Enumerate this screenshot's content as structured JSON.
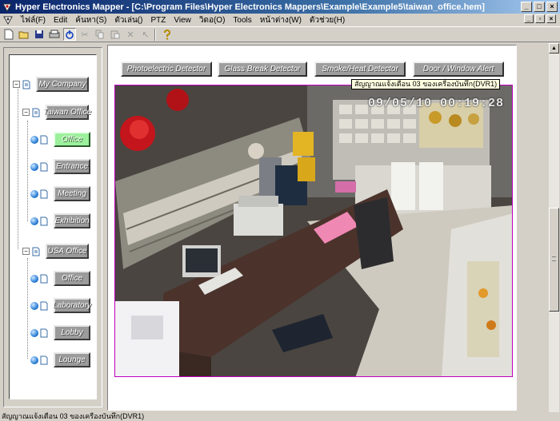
{
  "window": {
    "title": "Hyper Electronics Mapper - [C:\\Program Files\\Hyper Electronics Mappers\\Example\\Example5\\taiwan_office.hem]"
  },
  "menu": {
    "items": [
      "ไฟล์(F)",
      "Edit",
      "ค้นหา(S)",
      "ตัวเล่น()",
      "PTZ",
      "View",
      "วิดอ(O)",
      "Tools",
      "หน้าต่าง(W)",
      "ตัวช่วย(H)"
    ]
  },
  "toolbar": {
    "icons": [
      "new-icon",
      "open-icon",
      "save-icon",
      "print-icon",
      "power-icon",
      "cut-icon",
      "copy-icon",
      "paste-icon",
      "delete-icon",
      "pointer-icon",
      "help-icon"
    ]
  },
  "tree": {
    "root": "My Company",
    "taiwan_office": "Taiwan Office",
    "taiwan_children": [
      "Office",
      "Entrance",
      "Meeting",
      "Exhibition"
    ],
    "usa_office": "USA Office",
    "usa_children": [
      "Office",
      "Laboratory",
      "Lobby",
      "Lounge"
    ],
    "selected": "Office"
  },
  "alarms": {
    "buttons": [
      "Photoelectric Detector",
      "Glass Break Detector",
      "Smoke/Heat Detector",
      "Door / Window Alert"
    ]
  },
  "camera": {
    "timestamp": "09/05/10 00:19:28",
    "tooltip": "สัญญาณแจ้งเตือน 03 ของเครื่องบันทึก(DVR1)"
  },
  "statusbar": {
    "text": "สัญญาณแจ้งเตือน 03 ของเครื่องบันทึก(DVR1)"
  },
  "colors": {
    "titlebar": "#0a246a",
    "selected_node": "#9cf09c",
    "cam_border": "#c000c0"
  }
}
